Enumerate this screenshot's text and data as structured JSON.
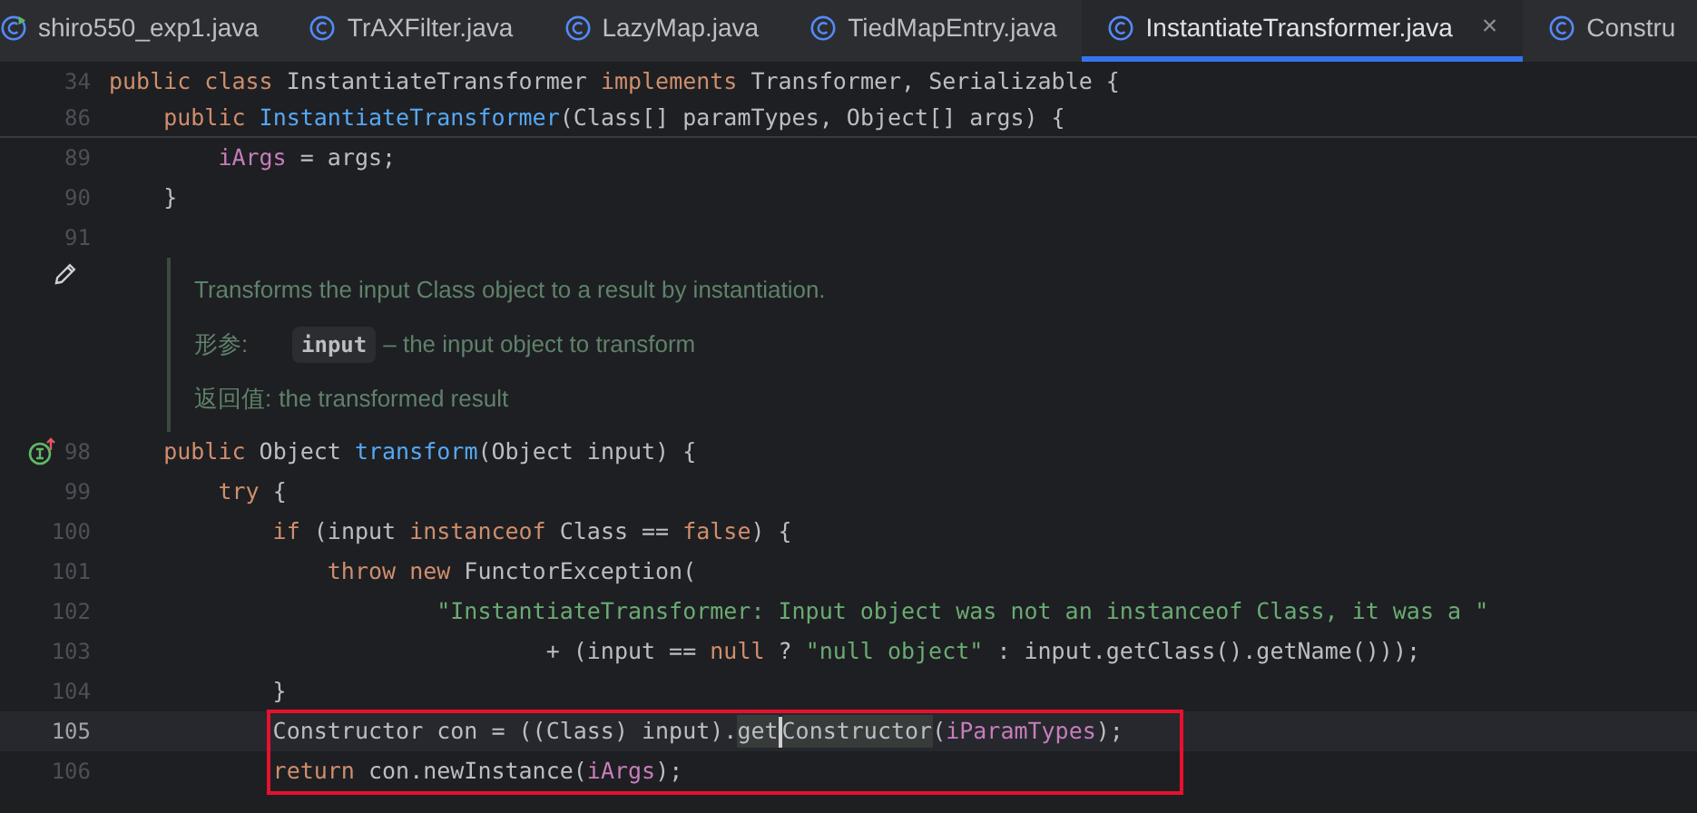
{
  "tabs": [
    {
      "label": "shiro550_exp1.java",
      "kind": "runnable",
      "selected": false
    },
    {
      "label": "TrAXFilter.java",
      "kind": "class",
      "selected": false
    },
    {
      "label": "LazyMap.java",
      "kind": "class",
      "selected": false
    },
    {
      "label": "TiedMapEntry.java",
      "kind": "class",
      "selected": false
    },
    {
      "label": "InstantiateTransformer.java",
      "kind": "class",
      "selected": true,
      "close": "×"
    },
    {
      "label": "Constru",
      "kind": "class",
      "selected": false
    }
  ],
  "sticky_lines": [
    {
      "number": "34",
      "segments": [
        {
          "text": "public class ",
          "kind": "keyword"
        },
        {
          "text": "InstantiateTransformer ",
          "kind": "plain"
        },
        {
          "text": "implements ",
          "kind": "keyword"
        },
        {
          "text": "Transformer, Serializable {",
          "kind": "plain"
        }
      ]
    },
    {
      "number": "86",
      "segments": [
        {
          "text": "    public ",
          "kind": "keyword"
        },
        {
          "text": "InstantiateTransformer",
          "kind": "method"
        },
        {
          "text": "(Class[] paramTypes, Object[] args) {",
          "kind": "plain"
        }
      ]
    }
  ],
  "lines_before_doc": [
    {
      "number": "89",
      "segments": [
        {
          "text": "        iArgs",
          "kind": "field"
        },
        {
          "text": " = args;",
          "kind": "plain"
        }
      ]
    },
    {
      "number": "90",
      "segments": [
        {
          "text": "    }",
          "kind": "plain"
        }
      ]
    },
    {
      "number": "91"
    }
  ],
  "doc": {
    "summary": "Transforms the input Class object to a result by instantiation.",
    "params_label": "形参:",
    "param_name": "input",
    "param_desc": "– the input object to transform",
    "returns_label": "返回值:",
    "returns_desc": "the transformed result"
  },
  "lines": [
    {
      "number": "98",
      "kind": "implementing",
      "segments": [
        {
          "text": "    public ",
          "kind": "keyword"
        },
        {
          "text": "Object ",
          "kind": "plain"
        },
        {
          "text": "transform",
          "kind": "method"
        },
        {
          "text": "(Object input) {",
          "kind": "plain"
        }
      ]
    },
    {
      "number": "99",
      "segments": [
        {
          "text": "        try ",
          "kind": "keyword"
        },
        {
          "text": "{",
          "kind": "plain"
        }
      ]
    },
    {
      "number": "100",
      "segments": [
        {
          "text": "            if ",
          "kind": "keyword"
        },
        {
          "text": "(input ",
          "kind": "plain"
        },
        {
          "text": "instanceof ",
          "kind": "keyword"
        },
        {
          "text": "Class == ",
          "kind": "plain"
        },
        {
          "text": "false",
          "kind": "keyword"
        },
        {
          "text": ") {",
          "kind": "plain"
        }
      ]
    },
    {
      "number": "101",
      "segments": [
        {
          "text": "                throw new ",
          "kind": "keyword"
        },
        {
          "text": "FunctorException(",
          "kind": "plain"
        }
      ]
    },
    {
      "number": "102",
      "segments": [
        {
          "text": "                        \"InstantiateTransformer: Input object was not an instanceof Class, it was a \"",
          "kind": "string"
        }
      ]
    },
    {
      "number": "103",
      "segments": [
        {
          "text": "                                + (input == ",
          "kind": "plain"
        },
        {
          "text": "null",
          "kind": "keyword"
        },
        {
          "text": " ? ",
          "kind": "plain"
        },
        {
          "text": "\"null object\"",
          "kind": "string"
        },
        {
          "text": " : input.getClass().getName()));",
          "kind": "plain"
        }
      ]
    },
    {
      "number": "104",
      "segments": [
        {
          "text": "            }",
          "kind": "plain"
        }
      ]
    },
    {
      "number": "105",
      "current": true,
      "boxed": true,
      "segments": [
        {
          "text": "            Constructor con = ((Class) input).",
          "kind": "plain"
        },
        {
          "text": "get",
          "kind": "usage",
          "caret_after": true
        },
        {
          "text": "Constructor",
          "kind": "usage"
        },
        {
          "text": "(",
          "kind": "plain"
        },
        {
          "text": "iParamTypes",
          "kind": "field"
        },
        {
          "text": ");",
          "kind": "plain"
        }
      ]
    },
    {
      "number": "106",
      "boxed": true,
      "segments": [
        {
          "text": "            return ",
          "kind": "keyword"
        },
        {
          "text": "con.newInstance(",
          "kind": "plain"
        },
        {
          "text": "iArgs",
          "kind": "field"
        },
        {
          "text": ");",
          "kind": "plain"
        }
      ]
    }
  ]
}
